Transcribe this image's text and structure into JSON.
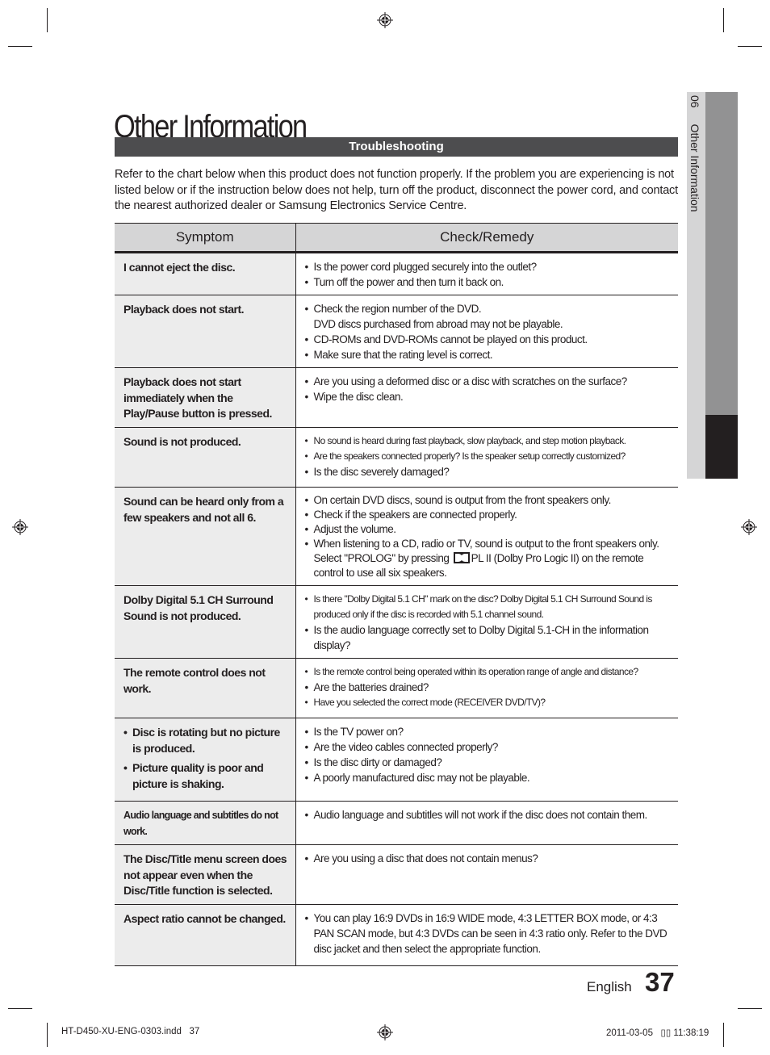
{
  "page": {
    "title": "Other Information",
    "section_heading": "Troubleshooting",
    "intro": "Refer to the chart below when this product does not function properly. If the problem you are experiencing is not listed below or if the instruction below does not help, turn off the product, disconnect the power cord, and contact the nearest authorized dealer or Samsung Electronics Service Centre.",
    "side_tab": {
      "number": "06",
      "label": "Other Information"
    },
    "colors": {
      "section_bar": "#4d4d4f",
      "header_bg": "#d5d5d6",
      "symptom_bg": "#ececec",
      "tab_gray": "#929293",
      "tab_dark": "#231f20"
    }
  },
  "table": {
    "headers": {
      "symptom": "Symptom",
      "remedy": "Check/Remedy"
    },
    "rows": [
      {
        "symptom": "I cannot eject the disc.",
        "remedies": [
          "Is the power cord plugged securely into the outlet?",
          "Turn off the power and then turn it back on."
        ]
      },
      {
        "symptom": "Playback does not start.",
        "remedies": [
          "Check the region number of the DVD.",
          "CD-ROMs and DVD-ROMs cannot be played on this product.",
          "Make sure that the rating level is correct."
        ],
        "remedy_continuation": "DVD discs purchased from abroad may not be playable."
      },
      {
        "symptom": "Playback does not start immediately when the Play/Pause button is pressed.",
        "remedies": [
          "Are you using a deformed disc or a disc with scratches on the surface?",
          "Wipe the disc clean."
        ]
      },
      {
        "symptom": "Sound is not produced.",
        "remedies": [
          "No sound is heard during fast playback, slow playback, and step motion playback.",
          "Are the speakers connected properly? Is the speaker setup correctly customized?",
          "Is the disc severely damaged?"
        ]
      },
      {
        "symptom": "Sound can be heard only from a few speakers and not all 6.",
        "remedies": [
          "On certain DVD discs, sound is output from the front speakers only.",
          "Check if the speakers are connected properly.",
          "Adjust the volume.",
          "When listening to a CD, radio or TV, sound is output to the front speakers only."
        ],
        "remedy_tail_before_icon": "Select \"PROLOG\" by pressing",
        "remedy_tail_after_icon": "PL II (Dolby Pro Logic II) on the remote control to use all six speakers.",
        "icon": "dolby-double-d-icon"
      },
      {
        "symptom": "Dolby Digital 5.1 CH Surround Sound is not produced.",
        "remedies": [
          "Is there \"Dolby Digital 5.1 CH\" mark on the disc? Dolby Digital 5.1 CH Surround Sound is produced only if the disc is recorded with 5.1 channel sound.",
          "Is the audio language correctly set to Dolby Digital 5.1-CH in the information display?"
        ]
      },
      {
        "symptom": "The remote control does not work.",
        "remedies": [
          "Is the remote control being operated within its operation range of angle and distance?",
          "Are the batteries drained?",
          "Have you selected the correct mode (RECEIVER DVD/TV)?"
        ]
      },
      {
        "symptoms": [
          "Disc is rotating but no picture is produced.",
          "Picture quality is poor and picture is shaking."
        ],
        "remedies": [
          "Is the TV power on?",
          "Are the video cables connected properly?",
          "Is the disc dirty or damaged?",
          "A poorly manufactured disc may not be playable."
        ]
      },
      {
        "symptom": "Audio language and subtitles do not work.",
        "remedies": [
          "Audio language and subtitles will not work if the disc does not contain them."
        ]
      },
      {
        "symptom": "The Disc/Title menu screen does not appear even when the Disc/Title function is selected.",
        "remedies": [
          "Are you using a disc that does not contain menus?"
        ]
      },
      {
        "symptom": "Aspect ratio cannot be changed.",
        "remedies": [
          "You can play 16:9 DVDs in 16:9 WIDE mode, 4:3 LETTER BOX mode, or 4:3 PAN SCAN mode, but 4:3 DVDs can be seen in 4:3 ratio only. Refer to the DVD disc jacket and then select the appropriate function."
        ]
      }
    ]
  },
  "footer": {
    "language": "English",
    "page_number": "37",
    "slug_file": "HT-D450-XU-ENG-0303.indd   37",
    "slug_date": "2011-03-05   ▯▯ 11:38:19"
  }
}
